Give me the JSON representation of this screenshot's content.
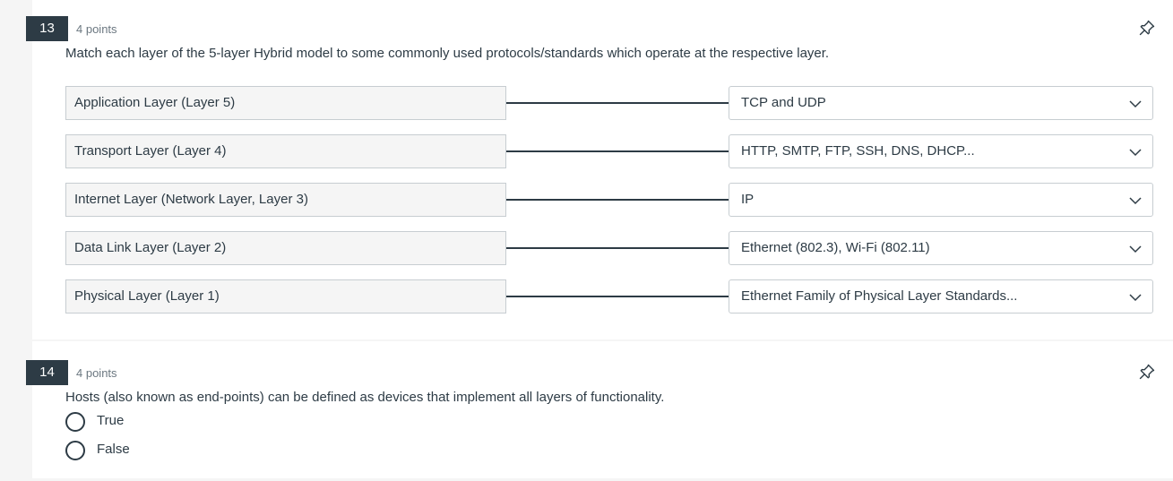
{
  "q13": {
    "number": "13",
    "points": "4 points",
    "text": "Match each layer of the 5-layer Hybrid model to some commonly used protocols/standards which operate at the respective layer.",
    "rows": [
      {
        "left": "Application Layer (Layer 5)",
        "selected": "TCP and UDP"
      },
      {
        "left": "Transport Layer (Layer 4)",
        "selected": "HTTP, SMTP, FTP, SSH, DNS, DHCP..."
      },
      {
        "left": "Internet Layer (Network Layer, Layer 3)",
        "selected": "IP"
      },
      {
        "left": "Data Link Layer (Layer 2)",
        "selected": "Ethernet (802.3), Wi-Fi (802.11)"
      },
      {
        "left": "Physical Layer (Layer 1)",
        "selected": "Ethernet Family of Physical Layer Standards..."
      }
    ]
  },
  "q14": {
    "number": "14",
    "points": "4 points",
    "text": "Hosts (also known as end-points) can be defined as devices that implement all layers of functionality.",
    "options": [
      "True",
      "False"
    ]
  },
  "icons": {
    "pin": "pin-icon",
    "dropdown": "chevron-down-icon",
    "radio": "radio-unselected"
  },
  "colors": {
    "primary_text": "#2d3b45",
    "secondary_text": "#6b7780",
    "border": "#c7cdd1",
    "page_background": "#f5f5f5"
  }
}
